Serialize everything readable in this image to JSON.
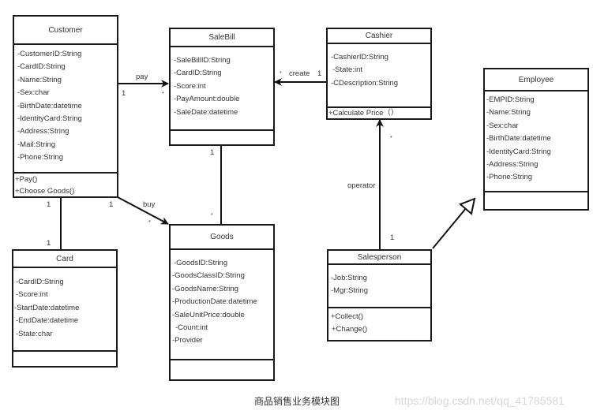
{
  "diagram": {
    "caption": "商品销售业务模块图",
    "watermark": "https://blog.csdn.net/qq_41785581",
    "classes": {
      "customer": {
        "name": "Customer",
        "attributes": [
          "-CustomerID:String",
          "-CardID:String",
          "-Name:String",
          "-Sex:char",
          "-BirthDate:datetime",
          "-IdentityCard:String",
          "-Address:String",
          "-Mail:String",
          "-Phone:String"
        ],
        "methods": [
          "+Pay()",
          "+Choose Goods()"
        ]
      },
      "salebill": {
        "name": "SaleBill",
        "attributes": [
          "-SaleBillID:String",
          "-CardID:String",
          "-Score:int",
          "-PayAmount:double",
          "-SaleDate:datetime"
        ],
        "methods": []
      },
      "cashier": {
        "name": "Cashier",
        "attributes": [
          "-CashierID:String",
          "-State:int",
          "-CDescription:String"
        ],
        "methods": [
          "+Calculate Price（）"
        ]
      },
      "employee": {
        "name": "Employee",
        "attributes": [
          "-EMPID:String",
          "-Name:String",
          "-Sex:char",
          "-BirthDate:datetime",
          "-IdentityCard:String",
          "-Address:String",
          "-Phone:String"
        ],
        "methods": []
      },
      "goods": {
        "name": "Goods",
        "attributes": [
          "-GoodsID:String",
          "-GoodsClassID:String",
          "-GoodsName:String",
          "-ProductionDate:datetime",
          "-SaleUnitPrice:double",
          "-Count:int",
          "-Provider"
        ],
        "methods": []
      },
      "card": {
        "name": "Card",
        "attributes": [
          "-CardID:String",
          "-Score:int",
          "-StartDate:datetime",
          "-EndDate:datetime",
          "-State:char"
        ],
        "methods": []
      },
      "salesperson": {
        "name": "Salesperson",
        "attributes": [
          "-Job:String",
          "-Mgr:String"
        ],
        "methods": [
          "+Collect()",
          "+Change()"
        ]
      }
    },
    "relations": {
      "pay": {
        "label": "pay",
        "from_mult": "1",
        "to_mult": "*"
      },
      "create": {
        "label": "create",
        "from_mult": "1",
        "to_mult": "*"
      },
      "buy": {
        "label": "buy",
        "from_mult": "1",
        "to_mult": "*"
      },
      "has_card": {
        "from_mult": "1",
        "to_mult": "1"
      },
      "bill_goods": {
        "from_mult": "1",
        "to_mult": "*"
      },
      "operator": {
        "label": "operator",
        "from_mult": "1",
        "to_mult": "*"
      },
      "inherits": {
        "type": "generalization"
      }
    }
  }
}
